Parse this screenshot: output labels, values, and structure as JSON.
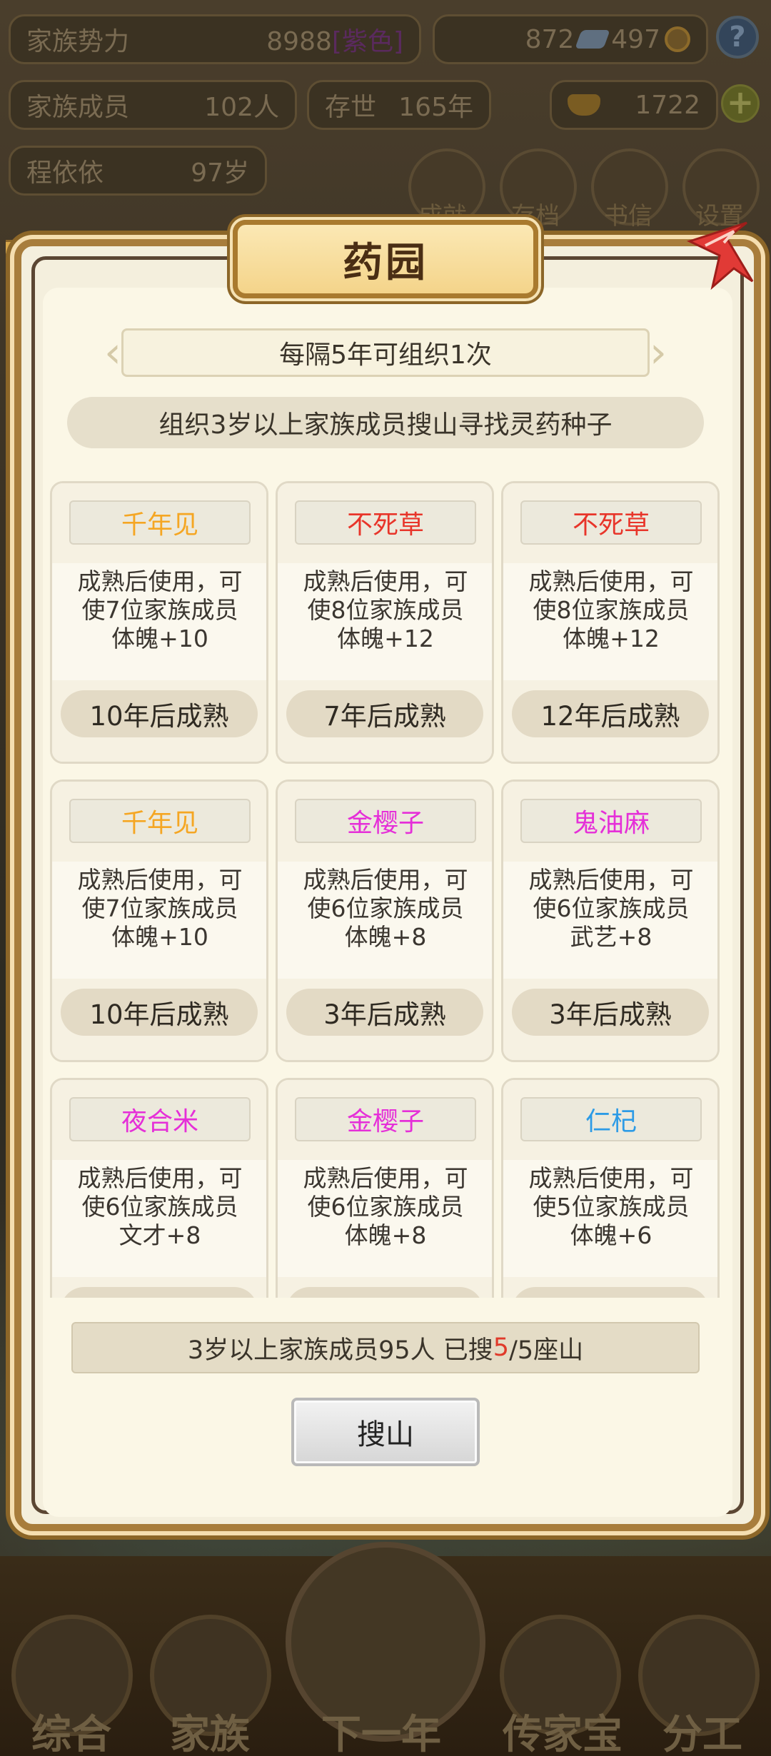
{
  "topbar": {
    "power_label": "家族势力",
    "power_value": "8988",
    "power_rank": "[紫色]",
    "gem_count": "872",
    "coin_count": "497",
    "members_label": "家族成员",
    "members_value": "102人",
    "age_label": "存世",
    "age_value": "165年",
    "gold_count": "1722",
    "person_name": "程依依",
    "person_age": "97岁",
    "icon_labels": [
      "成就",
      "存档",
      "书信",
      "设置"
    ]
  },
  "modal": {
    "title": "药园",
    "frequency": "每隔5年可组织1次",
    "description": "组织3岁以上家族成员搜山寻找灵药种子",
    "herbs": [
      {
        "name": "千年见",
        "color": "#f5a623",
        "line1": "成熟后使用，可",
        "line2": "使7位家族成员",
        "line3": "体魄+10",
        "mature": "10年后成熟"
      },
      {
        "name": "不死草",
        "color": "#e8352a",
        "line1": "成熟后使用，可",
        "line2": "使8位家族成员",
        "line3": "体魄+12",
        "mature": "7年后成熟"
      },
      {
        "name": "不死草",
        "color": "#e8352a",
        "line1": "成熟后使用，可",
        "line2": "使8位家族成员",
        "line3": "体魄+12",
        "mature": "12年后成熟"
      },
      {
        "name": "千年见",
        "color": "#f5a623",
        "line1": "成熟后使用，可",
        "line2": "使7位家族成员",
        "line3": "体魄+10",
        "mature": "10年后成熟"
      },
      {
        "name": "金樱子",
        "color": "#e52fd8",
        "line1": "成熟后使用，可",
        "line2": "使6位家族成员",
        "line3": "体魄+8",
        "mature": "3年后成熟"
      },
      {
        "name": "鬼油麻",
        "color": "#e52fd8",
        "line1": "成熟后使用，可",
        "line2": "使6位家族成员",
        "line3": "武艺+8",
        "mature": "3年后成熟"
      },
      {
        "name": "夜合米",
        "color": "#e52fd8",
        "line1": "成熟后使用，可",
        "line2": "使6位家族成员",
        "line3": "文才+8",
        "mature": ""
      },
      {
        "name": "金樱子",
        "color": "#e52fd8",
        "line1": "成熟后使用，可",
        "line2": "使6位家族成员",
        "line3": "体魄+8",
        "mature": ""
      },
      {
        "name": "仁杞",
        "color": "#2d9be6",
        "line1": "成熟后使用，可",
        "line2": "使5位家族成员",
        "line3": "体魄+6",
        "mature": ""
      }
    ],
    "status_prefix": "3岁以上家族成员95人 已搜",
    "status_searched": "5",
    "status_suffix": "/5座山",
    "search_button": "搜山"
  },
  "bottom_nav": [
    "综合",
    "家族",
    "下一年",
    "传家宝",
    "分工"
  ]
}
